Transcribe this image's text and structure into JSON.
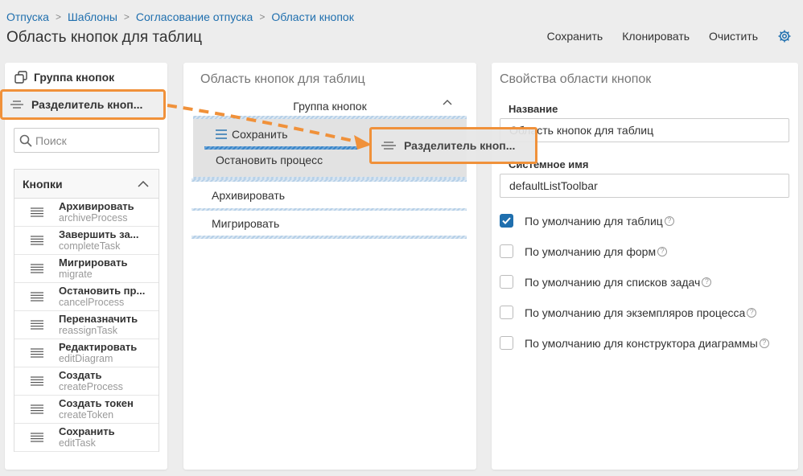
{
  "breadcrumb": [
    "Отпуска",
    "Шаблоны",
    "Согласование отпуска",
    "Области кнопок"
  ],
  "page_title": "Область кнопок для таблиц",
  "toolbar": {
    "save": "Сохранить",
    "clone": "Клонировать",
    "clear": "Очистить",
    "settings_icon": "gear-icon"
  },
  "left": {
    "group_label": "Группа кнопок",
    "separator_label": "Разделитель кноп...",
    "search_placeholder": "Поиск",
    "buttons_header": "Кнопки",
    "buttons": [
      {
        "title": "Архивировать",
        "code": "archiveProcess"
      },
      {
        "title": "Завершить за...",
        "code": "completeTask"
      },
      {
        "title": "Мигрировать",
        "code": "migrate"
      },
      {
        "title": "Остановить пр...",
        "code": "cancelProcess"
      },
      {
        "title": "Переназначить",
        "code": "reassignTask"
      },
      {
        "title": "Редактировать",
        "code": "editDiagram"
      },
      {
        "title": "Создать",
        "code": "createProcess"
      },
      {
        "title": "Создать токен",
        "code": "createToken"
      },
      {
        "title": "Сохранить",
        "code": "editTask"
      }
    ]
  },
  "middle": {
    "title": "Область кнопок для таблиц",
    "group_header": "Группа кнопок",
    "group_items": [
      "Сохранить",
      "Остановить процесс"
    ],
    "items": [
      "Архивировать",
      "Мигрировать"
    ],
    "drag_ghost_label": "Разделитель кноп..."
  },
  "right": {
    "title": "Свойства области кнопок",
    "name_label": "Название",
    "name_value": "Область кнопок для таблиц",
    "sysname_label": "Системное имя",
    "sysname_value": "defaultListToolbar",
    "checkboxes": [
      {
        "label": "По умолчанию для таблиц",
        "checked": true
      },
      {
        "label": "По умолчанию для форм",
        "checked": false
      },
      {
        "label": "По умолчанию для списков задач",
        "checked": false
      },
      {
        "label": "По умолчанию для экземпляров процесса",
        "checked": false
      },
      {
        "label": "По умолчанию для конструктора диаграммы",
        "checked": false
      }
    ]
  },
  "colors": {
    "accent": "#1f6fae",
    "highlight": "#f0913a"
  }
}
